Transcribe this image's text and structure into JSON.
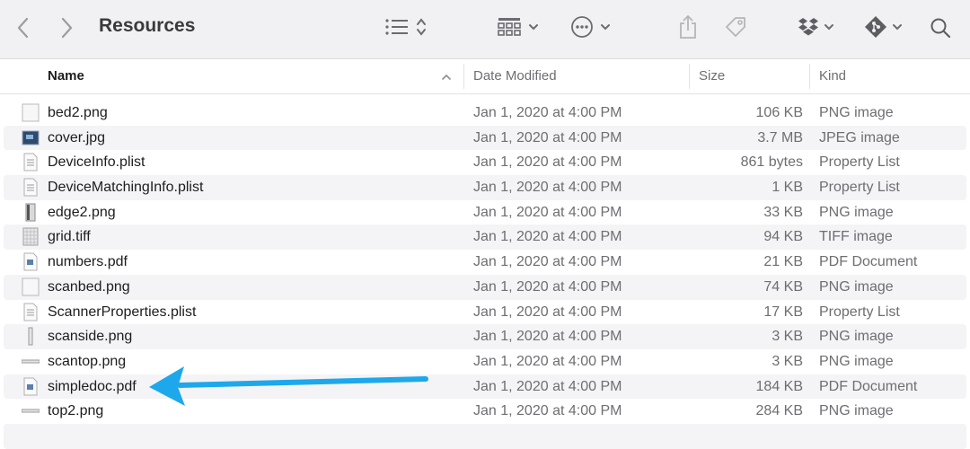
{
  "window": {
    "title": "Resources"
  },
  "columns": {
    "name": "Name",
    "date": "Date Modified",
    "size": "Size",
    "kind": "Kind"
  },
  "files": [
    {
      "name": "bed2.png",
      "date": "Jan 1, 2020 at 4:00 PM",
      "size": "106 KB",
      "kind": "PNG image",
      "icon": "png-blank-icon"
    },
    {
      "name": "cover.jpg",
      "date": "Jan 1, 2020 at 4:00 PM",
      "size": "3.7 MB",
      "kind": "JPEG image",
      "icon": "jpeg-image-icon"
    },
    {
      "name": "DeviceInfo.plist",
      "date": "Jan 1, 2020 at 4:00 PM",
      "size": "861 bytes",
      "kind": "Property List",
      "icon": "plist-icon"
    },
    {
      "name": "DeviceMatchingInfo.plist",
      "date": "Jan 1, 2020 at 4:00 PM",
      "size": "1 KB",
      "kind": "Property List",
      "icon": "plist-icon"
    },
    {
      "name": "edge2.png",
      "date": "Jan 1, 2020 at 4:00 PM",
      "size": "33 KB",
      "kind": "PNG image",
      "icon": "png-edge-icon"
    },
    {
      "name": "grid.tiff",
      "date": "Jan 1, 2020 at 4:00 PM",
      "size": "94 KB",
      "kind": "TIFF image",
      "icon": "tiff-grid-icon"
    },
    {
      "name": "numbers.pdf",
      "date": "Jan 1, 2020 at 4:00 PM",
      "size": "21 KB",
      "kind": "PDF Document",
      "icon": "pdf-icon"
    },
    {
      "name": "scanbed.png",
      "date": "Jan 1, 2020 at 4:00 PM",
      "size": "74 KB",
      "kind": "PNG image",
      "icon": "png-blank-icon"
    },
    {
      "name": "ScannerProperties.plist",
      "date": "Jan 1, 2020 at 4:00 PM",
      "size": "17 KB",
      "kind": "Property List",
      "icon": "plist-icon"
    },
    {
      "name": "scanside.png",
      "date": "Jan 1, 2020 at 4:00 PM",
      "size": "3 KB",
      "kind": "PNG image",
      "icon": "png-side-icon"
    },
    {
      "name": "scantop.png",
      "date": "Jan 1, 2020 at 4:00 PM",
      "size": "3 KB",
      "kind": "PNG image",
      "icon": "png-top-icon"
    },
    {
      "name": "simpledoc.pdf",
      "date": "Jan 1, 2020 at 4:00 PM",
      "size": "184 KB",
      "kind": "PDF Document",
      "icon": "pdf-icon"
    },
    {
      "name": "top2.png",
      "date": "Jan 1, 2020 at 4:00 PM",
      "size": "284 KB",
      "kind": "PNG image",
      "icon": "png-top-icon"
    }
  ],
  "colors": {
    "arrow": "#1ea8ec",
    "toolbar_bg": "#f1f0f3",
    "row_alt": "#f4f4f6"
  }
}
